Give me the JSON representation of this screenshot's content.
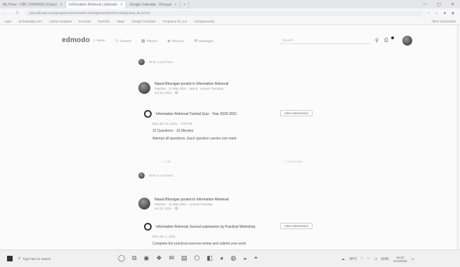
{
  "browser": {
    "tabs": [
      {
        "label": "My Drive - CBC 2024/2025 (Class)",
        "active": false
      },
      {
        "label": "Information Retrieval | Edmodo",
        "active": true
      },
      {
        "label": "Google Calendar - Dhrupal",
        "active": false
      }
    ],
    "new_tab": "+",
    "window_controls": [
      "—",
      "▢",
      "✕"
    ],
    "url": "new.edmodo.com/groups/communication-1/assignment/20/info?assignment_id=42713",
    "nav_icons": [
      "←",
      "→",
      "C"
    ],
    "ext_icons": [
      "☆",
      "◐",
      "■",
      "◉"
    ],
    "bookmarks": [
      "Apps",
      "Sinhaladaily.com",
      "Lanka Hospitals",
      "M Gmail",
      "YouTube",
      "Maps",
      "Google Translate",
      "Programs for you",
      "myOpportunity"
    ],
    "bookmarks_right": "Other bookmarks"
  },
  "app": {
    "logo": "edmodo",
    "nav": [
      {
        "icon": "⌂",
        "label": "Home"
      },
      {
        "icon": "⚇",
        "label": "Classes"
      },
      {
        "icon": "▦",
        "label": "Planner"
      },
      {
        "icon": "◈",
        "label": "Discover"
      },
      {
        "icon": "✉",
        "label": "Messages"
      }
    ],
    "search_placeholder": "Search",
    "search_icon": "search-icon",
    "icons": [
      "⚲",
      "⎙"
    ]
  },
  "feed": {
    "post_prompt": "Write a post here...",
    "posts": [
      {
        "author": "Nawal Bhuvigan posted in Information Retrieval",
        "detail": "Teacher · 11 May 2021 · Mar 8 · Lesson Tuesday",
        "time": "Jul 13, 2021 · 👁",
        "assignment_title": "Information Retrieval Tutorial Quiz - Year 2020-2021",
        "button": "View Submission",
        "due": "Due Jan 20, 2021 · 7:03 PM",
        "line1": "10 Questions · 10 Minutes",
        "line2": "Attempt all questions. Each question carries one mark.",
        "actions": [
          "Like",
          "Comment"
        ]
      },
      {
        "author": "Nawal Bhuvigan posted to Information Retrieval",
        "detail": "Teacher · 11 May 2021 · Lesson Tuesday",
        "time": "Jul 13, 2021 · 👁",
        "assignment_title": "Information Retrieval Journal submission by Practical Workshop",
        "button": "View Submission",
        "due": "Due Jun 1, 2021",
        "line1": "Complete the practical exercise below and submit your work"
      }
    ],
    "comment_prompt": "Write a comment..."
  },
  "taskbar": {
    "search": "Type here to search",
    "icons": [
      "◯",
      "⧉",
      "◉",
      "❖",
      "✉",
      "▤",
      "⬡",
      "◧",
      "◕",
      "◍",
      "◒",
      "◓"
    ],
    "weather": "28°C",
    "lang": "ENG",
    "time": "10:22",
    "date": "1/12/2022"
  }
}
